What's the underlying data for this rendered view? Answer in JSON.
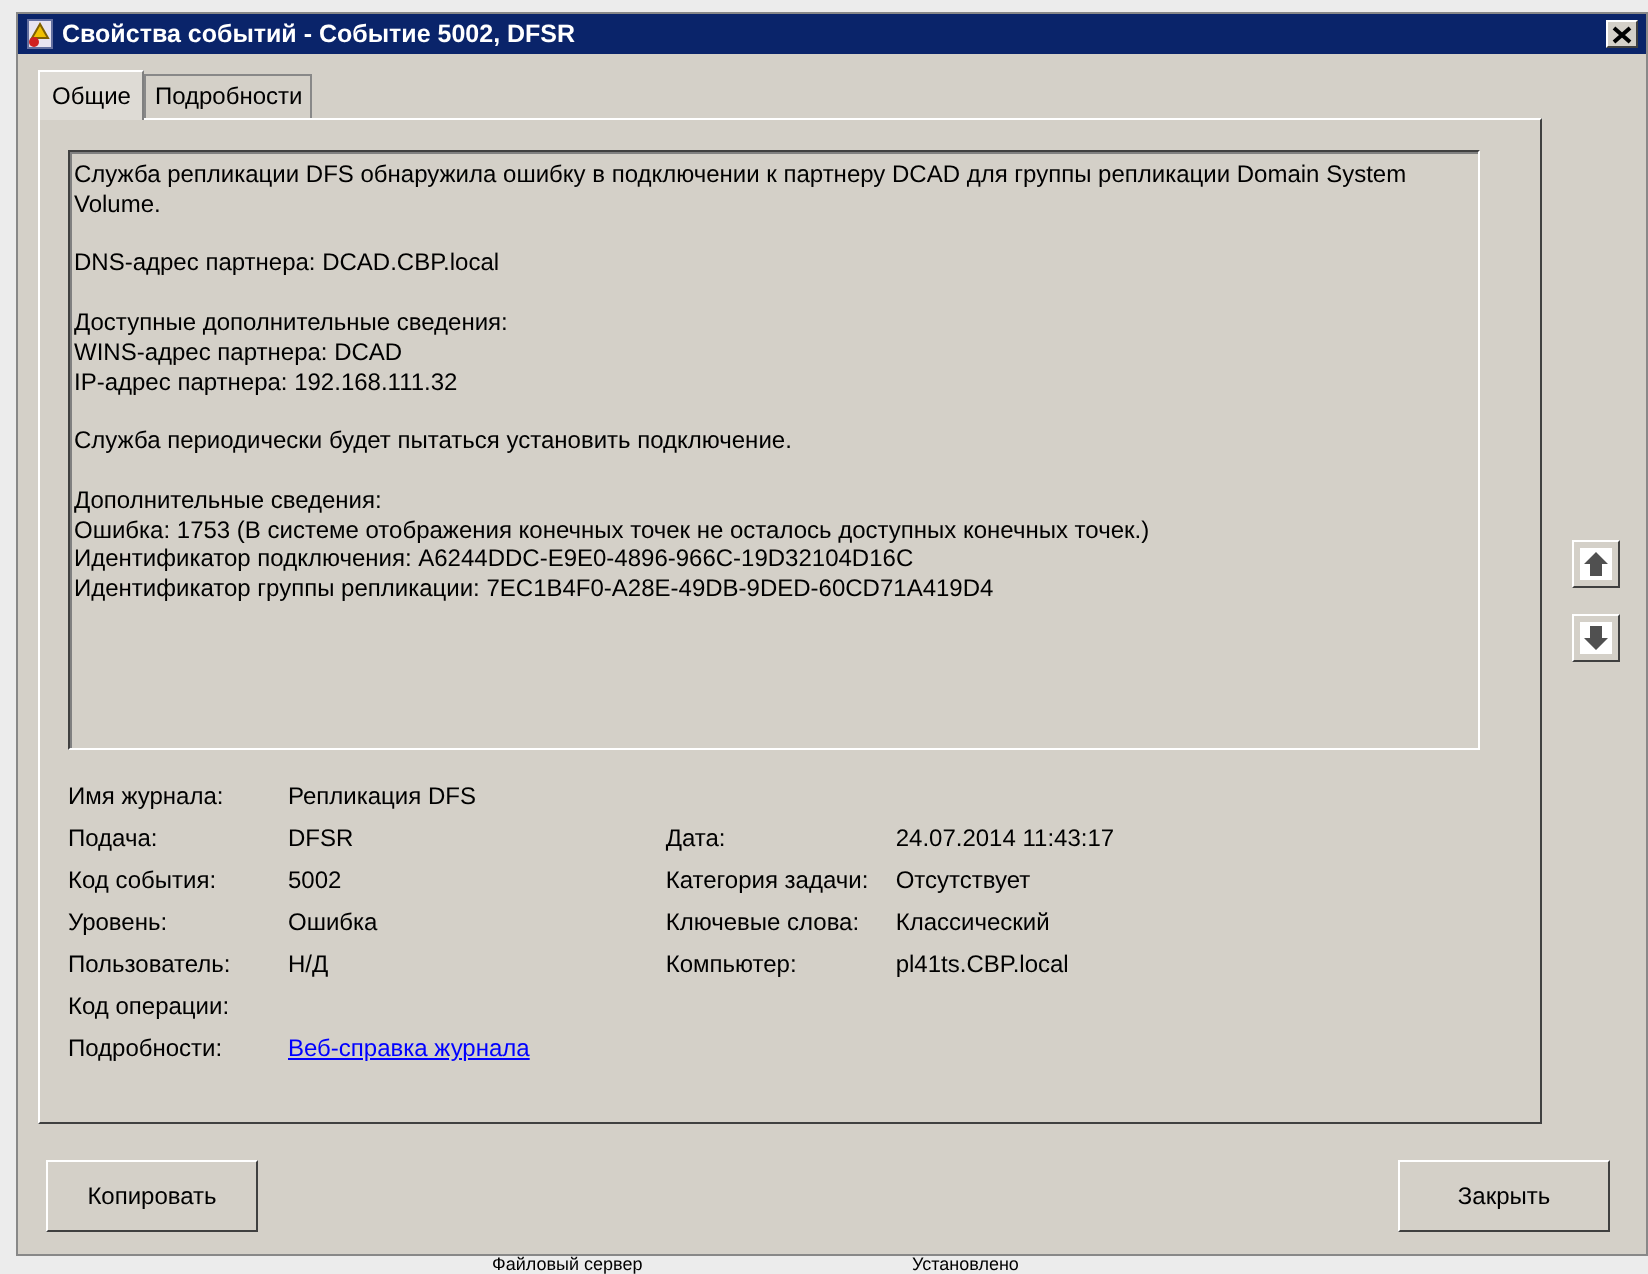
{
  "window": {
    "title": "Свойства событий - Событие 5002, DFSR"
  },
  "tabs": [
    {
      "label": "Общие",
      "selected": true
    },
    {
      "label": "Подробности",
      "selected": false
    }
  ],
  "message": [
    [
      "Служба репликации DFS обнаружила ошибку в подключении к партнеру DCAD для группы репликации Domain System Volume."
    ],
    [
      "DNS-адрес партнера: DCAD.CBP.local"
    ],
    [
      "Доступные дополнительные сведения:",
      "WINS-адрес партнера: DCAD",
      "IP-адрес партнера: 192.168.111.32"
    ],
    [
      "Служба периодически будет пытаться установить подключение."
    ],
    [
      "Дополнительные сведения:",
      "Ошибка: 1753 (В системе отображения конечных точек не осталось доступных конечных точек.)",
      "Идентификатор подключения: A6244DDC-E9E0-4896-966C-19D32104D16C",
      "Идентификатор группы репликации: 7EC1B4F0-A28E-49DB-9DED-60CD71A419D4"
    ]
  ],
  "fields_left": [
    {
      "label": "Имя журнала:",
      "value": "Репликация DFS"
    },
    {
      "label": "Подача:",
      "value": "DFSR"
    },
    {
      "label": "Код события:",
      "value": "5002"
    },
    {
      "label": "Уровень:",
      "value": "Ошибка"
    },
    {
      "label": "Пользователь:",
      "value": "Н/Д"
    },
    {
      "label": "Код операции:"
    },
    {
      "label": "Подробности:",
      "value": "Веб-справка журнала",
      "kind": "link"
    }
  ],
  "fields_right": [
    {
      "label": "Дата:",
      "value": "24.07.2014 11:43:17"
    },
    {
      "label": "Категория задачи:",
      "value": "Отсутствует"
    },
    {
      "label": "Ключевые слова:",
      "value": "Классический"
    },
    {
      "label": "Компьютер:",
      "value": "pl41ts.CBP.local"
    }
  ],
  "buttons": [
    {
      "label": "Копировать"
    },
    {
      "label": "Закрыть"
    }
  ],
  "background": {
    "cells": [
      "Файловый сервер",
      "Установлено"
    ]
  }
}
